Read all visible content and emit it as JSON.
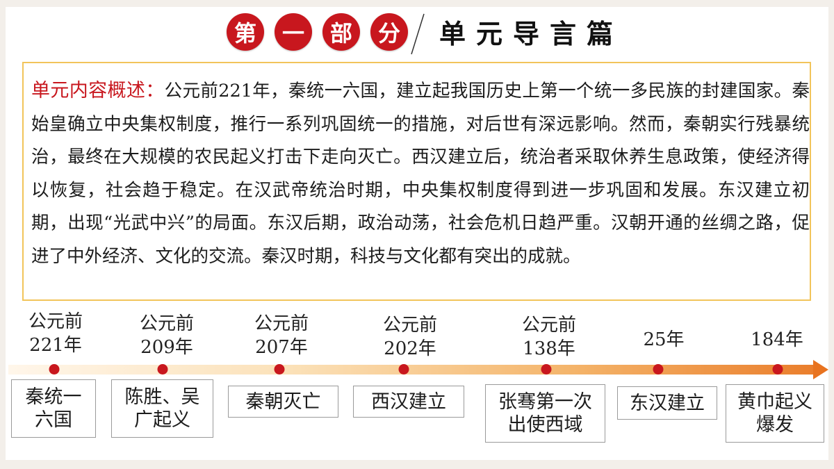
{
  "header": {
    "circles": [
      "第",
      "一",
      "部",
      "分"
    ],
    "title": "单元导言篇"
  },
  "summary": {
    "label": "单元内容概述：",
    "text": "公元前221年，秦统一六国，建立起我国历史上第一个统一多民族的封建国家。秦始皇确立中央集权制度，推行一系列巩固统一的措施，对后世有深远影响。然而，秦朝实行残暴统治，最终在大规模的农民起义打击下走向灭亡。西汉建立后，统治者采取休养生息政策，使经济得以恢复，社会趋于稳定。在汉武帝统治时期，中央集权制度得到进一步巩固和发展。东汉建立初期，出现“光武中兴”的局面。东汉后期，政治动荡，社会危机日趋严重。汉朝开通的丝绸之路，促进了中外经济、文化的交流。秦汉时期，科技与文化都有突出的成就。"
  },
  "timeline": {
    "events": [
      {
        "date_line1": "公元前",
        "date_line2": "221年",
        "event": "秦统一\n六国"
      },
      {
        "date_line1": "公元前",
        "date_line2": "209年",
        "event": "陈胜、吴\n广起义"
      },
      {
        "date_line1": "公元前",
        "date_line2": "207年",
        "event": "秦朝灭亡"
      },
      {
        "date_line1": "公元前",
        "date_line2": "202年",
        "event": "西汉建立"
      },
      {
        "date_line1": "公元前",
        "date_line2": "138年",
        "event": "张骞第一次\n出使西域"
      },
      {
        "date_line1": "",
        "date_line2": "25年",
        "event": "东汉建立"
      },
      {
        "date_line1": "",
        "date_line2": "184年",
        "event": "黄巾起义\n爆发"
      }
    ]
  },
  "colors": {
    "accent_red": "#c8171e",
    "box_border": "#f2c45a",
    "timeline_end": "#e8731f"
  }
}
